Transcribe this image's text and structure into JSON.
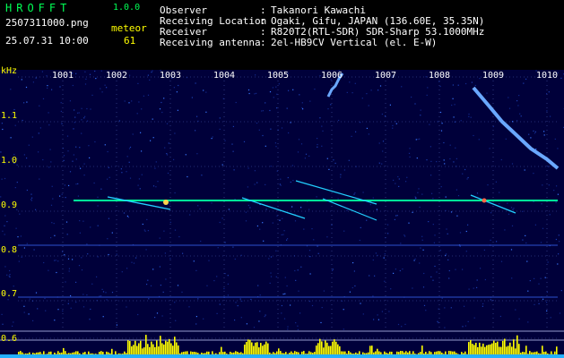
{
  "app": {
    "name": "HROFFT",
    "version": "1.0.0"
  },
  "file": {
    "name": "2507311000.png",
    "datetime": "25.07.31 10:00"
  },
  "meteor": {
    "label": "meteor",
    "count": "61"
  },
  "info": [
    {
      "key": "Observer",
      "sep": ":",
      "value": "Takanori Kawachi"
    },
    {
      "key": "Receiving Location",
      "sep": ":",
      "value": "Ogaki, Gifu, JAPAN (136.60E, 35.35N)"
    },
    {
      "key": "Receiver",
      "sep": ":",
      "value": "R820T2(RTL-SDR) SDR-Sharp 53.1000MHz"
    },
    {
      "key": "Receiving antenna",
      "sep": ":",
      "value": "2el-HB9CV Vertical (el. E-W)"
    }
  ],
  "axis": {
    "unit": "kHz",
    "y_ticks": [
      "1.1",
      "1.0",
      "0.9",
      "0.8",
      "0.7",
      "0.6"
    ],
    "x_ticks": [
      "1001",
      "1002",
      "1003",
      "1004",
      "1005",
      "1006",
      "1007",
      "1008",
      "1009",
      "1010"
    ]
  },
  "colors": {
    "background": "#00003a",
    "grid": "#4a5aa8",
    "signal": "#00ff9a",
    "histogram": "#ffff00"
  }
}
